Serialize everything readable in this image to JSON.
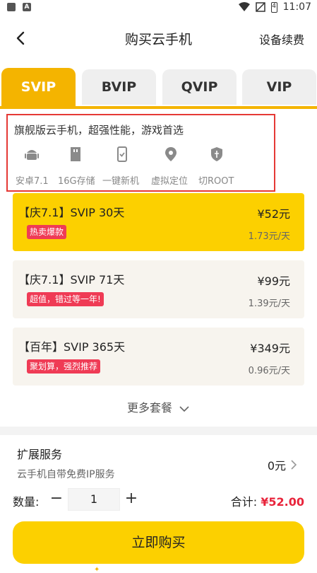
{
  "status_bar": {
    "time": "11:07",
    "battery": "4"
  },
  "nav": {
    "title": "购买云手机",
    "right_label": "设备续费"
  },
  "tabs": [
    {
      "label": "SVIP",
      "active": true
    },
    {
      "label": "BVIP",
      "active": false
    },
    {
      "label": "QVIP",
      "active": false
    },
    {
      "label": "VIP",
      "active": false
    }
  ],
  "features": {
    "headline": "旗舰版云手机，超强性能，游戏首选",
    "items": [
      {
        "label": "安卓7.1",
        "icon": "android-icon"
      },
      {
        "label": "16G存储",
        "icon": "sd-card-icon"
      },
      {
        "label": "一键新机",
        "icon": "phone-check-icon"
      },
      {
        "label": "虚拟定位",
        "icon": "location-pin-icon"
      },
      {
        "label": "切ROOT",
        "icon": "usb-shield-icon"
      }
    ]
  },
  "plans": [
    {
      "title": "【庆7.1】SVIP 30天",
      "badge": "热卖爆款",
      "price": "¥52元",
      "daily": "1.73元/天",
      "selected": true
    },
    {
      "title": "【庆7.1】SVIP 71天",
      "badge": "超值，错过等一年!",
      "price": "¥99元",
      "daily": "1.39元/天",
      "selected": false
    },
    {
      "title": "【百年】SVIP 365天",
      "badge": "聚划算，强烈推荐",
      "price": "¥349元",
      "daily": "0.96元/天",
      "selected": false
    }
  ],
  "more_label": "更多套餐",
  "extension": {
    "title": "扩展服务",
    "subtitle": "云手机自带免费IP服务",
    "value": "0元"
  },
  "quantity": {
    "label": "数量:",
    "minus": "−",
    "value": "1",
    "plus": "+"
  },
  "total": {
    "label": "合计:",
    "amount": "¥52.00"
  },
  "buy_label": "立即购买",
  "colors": {
    "accent": "#fcd000",
    "tab_active": "#f4b400",
    "badge": "#ef3b55",
    "highlight_border": "#e53935",
    "price_red": "#e8243b"
  }
}
